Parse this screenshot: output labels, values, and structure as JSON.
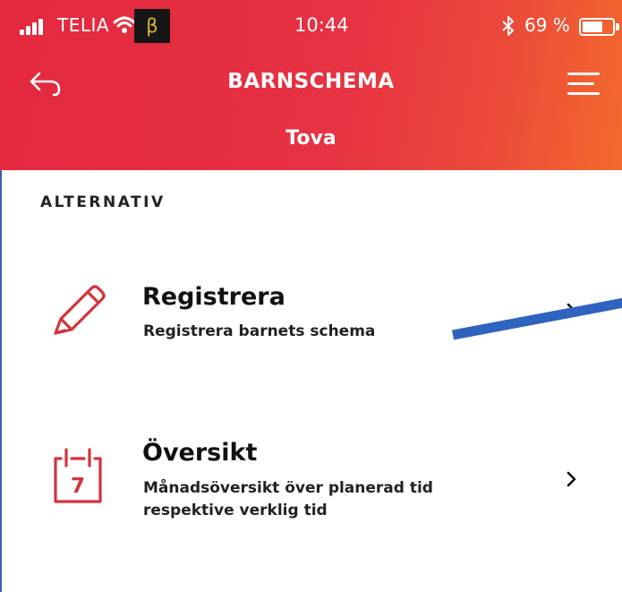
{
  "status_bar": {
    "carrier": "TELIA",
    "beta": "β",
    "time": "10:44",
    "battery_percent": "69 %",
    "battery_level": 0.69
  },
  "nav": {
    "title": "BARNSCHEMA",
    "back_icon": "back-arrow-icon",
    "menu_icon": "hamburger-menu-icon"
  },
  "child_name": "Tova",
  "section": {
    "label": "ALTERNATIV"
  },
  "options": [
    {
      "title": "Registrera",
      "subtitle": "Registrera barnets schema",
      "icon": "pencil-icon"
    },
    {
      "title": "Översikt",
      "subtitle": "Månadsöversikt över planerad tid respektive verklig tid",
      "icon": "calendar-icon",
      "icon_day": "7"
    }
  ],
  "colors": {
    "header_start": "#e4283f",
    "header_end": "#f26a2c",
    "icon_red": "#d3343c",
    "annotation_blue": "#2f63c0"
  }
}
